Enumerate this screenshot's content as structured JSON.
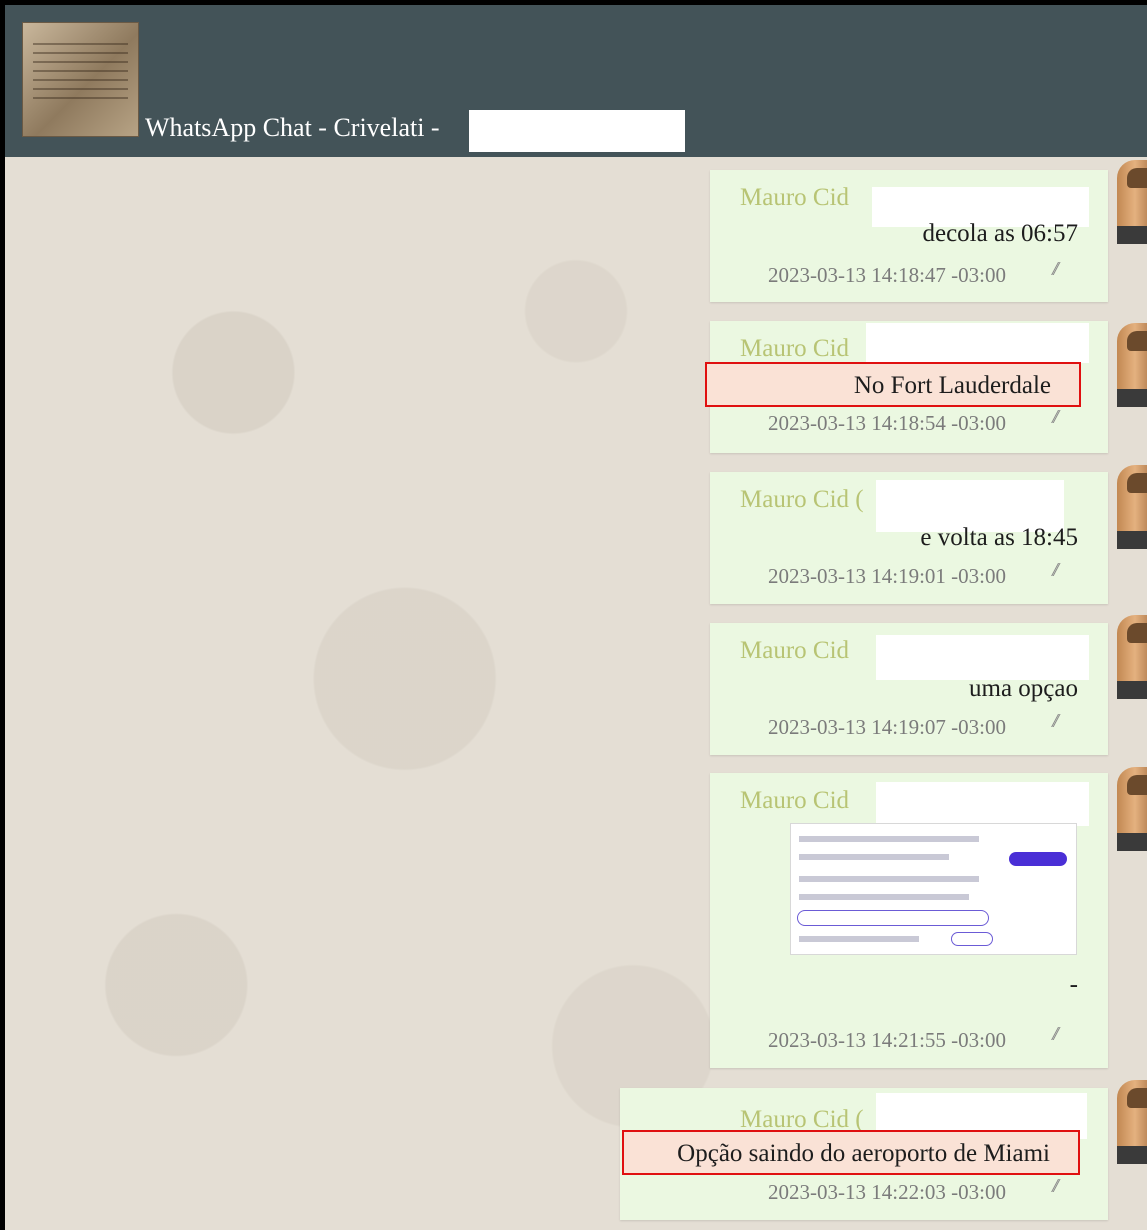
{
  "header": {
    "title": "WhatsApp Chat - Crivelati -"
  },
  "messages": [
    {
      "sender": "Mauro Cid",
      "text": "decola as 06:57",
      "time": "2023-03-13 14:18:47 -03:00"
    },
    {
      "sender": "Mauro Cid",
      "text": "No Fort Lauderdale",
      "time": "2023-03-13 14:18:54 -03:00"
    },
    {
      "sender": "Mauro Cid (",
      "text": "e volta as 18:45",
      "time": "2023-03-13 14:19:01 -03:00"
    },
    {
      "sender": "Mauro Cid",
      "text": "uma opçao",
      "time": "2023-03-13 14:19:07 -03:00"
    },
    {
      "sender": "Mauro Cid",
      "text": "-",
      "time": "2023-03-13 14:21:55 -03:00"
    },
    {
      "sender": "Mauro Cid (",
      "text": "Opção saindo do aeroporto de Miami",
      "time": "2023-03-13 14:22:03 -03:00"
    }
  ],
  "read_receipt_icon": "double-check-icon",
  "colors": {
    "header_bg": "#435358",
    "bubble_bg": "#ebf8e1",
    "sender_color": "#b8c474",
    "highlight_border": "#e01010"
  }
}
